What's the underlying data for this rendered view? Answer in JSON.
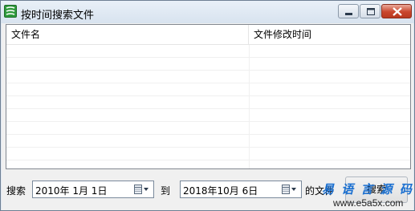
{
  "window": {
    "title": "按时间搜索文件",
    "icon": "app-logo-icon",
    "controls": [
      "minimize-icon",
      "maximize-icon",
      "close-icon"
    ]
  },
  "listview": {
    "columns": [
      "文件名",
      "文件修改时间"
    ],
    "rows": []
  },
  "search_bar": {
    "search_label": "搜索",
    "start_date": "2010年 1月 1日",
    "to_label": "到",
    "end_date": "2018年10月 6日",
    "suffix_label": "的文件",
    "search_button": "搜索",
    "calendar_icon": "calendar-dropdown-icon"
  },
  "watermark": {
    "text": "易 语 言 源 码 网",
    "url": "www.e5a5x.com"
  },
  "colors": {
    "titlebar": "#dfe8f2",
    "close_button": "#c9462c",
    "watermark": "#1a6fd0"
  }
}
